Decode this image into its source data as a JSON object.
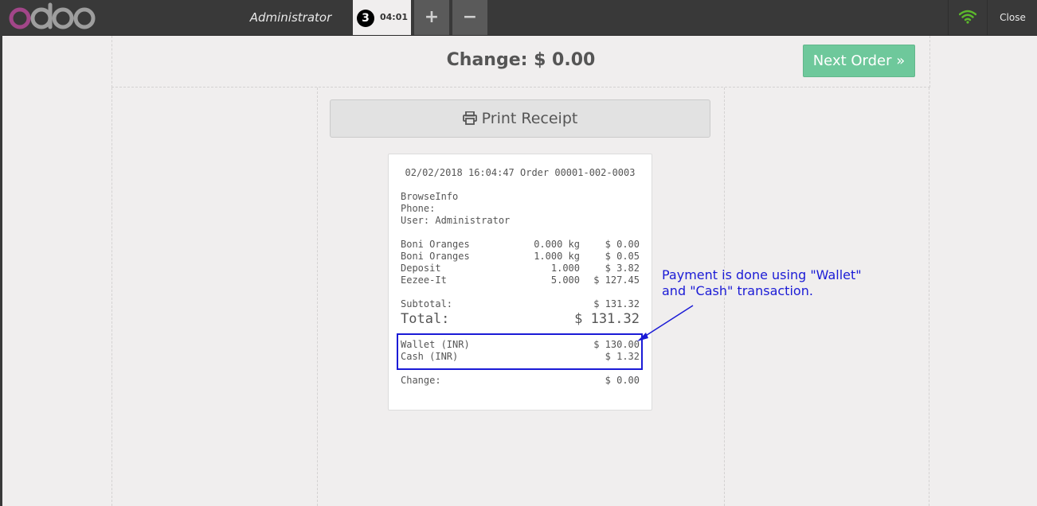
{
  "app": {
    "logo_text": "odoo",
    "user": "Administrator",
    "order_number": "3",
    "order_time": "04:01",
    "add_label": "+",
    "remove_label": "−",
    "close_label": "Close"
  },
  "screen": {
    "change_title": "Change: $ 0.00",
    "next_order_label": "Next Order »",
    "print_label": "Print Receipt"
  },
  "receipt": {
    "header": "02/02/2018 16:04:47 Order 00001-002-0003",
    "company": "BrowseInfo",
    "phone": "Phone:",
    "user": "User: Administrator",
    "lines": [
      {
        "name": "Boni Oranges",
        "qty": "0.000 kg",
        "price": "$ 0.00"
      },
      {
        "name": "Boni Oranges",
        "qty": "1.000 kg",
        "price": "$ 0.05"
      },
      {
        "name": "Deposit",
        "qty": "1.000",
        "price": "$ 3.82"
      },
      {
        "name": "Eezee-It",
        "qty": "5.000",
        "price": "$ 127.45"
      }
    ],
    "subtotal_label": "Subtotal:",
    "subtotal_value": "$ 131.32",
    "total_label": "Total:",
    "total_value": "$ 131.32",
    "payments": [
      {
        "name": "Wallet (INR)",
        "amount": "$ 130.00"
      },
      {
        "name": "Cash (INR)",
        "amount": "$ 1.32"
      }
    ],
    "change_label": "Change:",
    "change_value": "$ 0.00"
  },
  "annotation": {
    "line1": "Payment is done using \"Wallet\"",
    "line2": "and \"Cash\" transaction."
  },
  "colors": {
    "topbar": "#393939",
    "next_order": "#6ec89b",
    "annotation": "#1b1bd6",
    "wifi": "#5cb82c",
    "logo": "#a24689"
  }
}
